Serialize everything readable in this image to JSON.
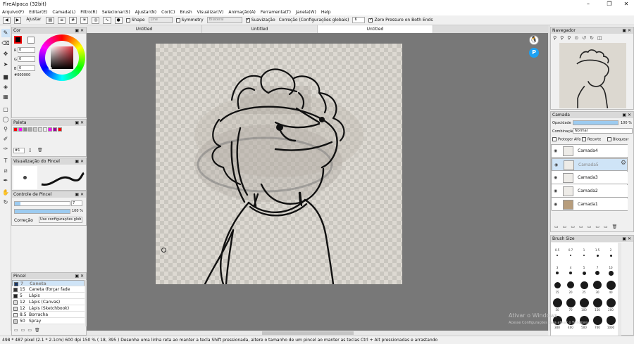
{
  "window": {
    "title": "FireAlpaca (32bit)"
  },
  "menu": [
    "Arquivo(F)",
    "Editar(E)",
    "Camada(L)",
    "Filtro(R)",
    "Selecionar(S)",
    "Ajustar(N)",
    "Cor(C)",
    "Brush",
    "Visualizar(V)",
    "Animação(A)",
    "Ferramenta(T)",
    "Janela(W)",
    "Help"
  ],
  "toolbar": {
    "adjust_label": "Ajustar",
    "shape_label": "Shape",
    "shape_value": "Line",
    "symmetry_label": "Symmetry",
    "symmetry_value": "Bilateral",
    "smoothing_label": "Suavização",
    "correction_label": "Correção (Configurações globais)",
    "correction_value": "6",
    "zero_pressure_label": "Zero Pressure on Both Ends"
  },
  "tabs": [
    "Untitled",
    "Untitled",
    "Untitled"
  ],
  "color_panel": {
    "title": "Cor",
    "r": "0",
    "g": "0",
    "b": "0",
    "hex": "#000000",
    "fg": "#000000",
    "bg": "#ffffff"
  },
  "palette_panel": {
    "title": "Paleta",
    "layer_select": "#1",
    "colors": [
      "#ff0000",
      "#ff00ff",
      "#888888",
      "#aaaaaa",
      "#cccccc",
      "#dddddd",
      "#eeeeee",
      "#ff00ff",
      "#990099",
      "#ff0000"
    ]
  },
  "brush_preview_panel": {
    "title": "Visualização do Pincel"
  },
  "brush_control_panel": {
    "title": "Controle de Pincel",
    "size": "7",
    "opacity": "100 %",
    "correction_label": "Correção",
    "correction_value": "Use configurações glob"
  },
  "brush_panel": {
    "title": "Pincel",
    "items": [
      {
        "size": "7",
        "name": "Caneta",
        "color": "#1a3a6a"
      },
      {
        "size": "15",
        "name": "Caneta (forçar fade in/out)",
        "color": "#333333"
      },
      {
        "size": "5",
        "name": "Lápis",
        "color": "#222222"
      },
      {
        "size": "12",
        "name": "Lápis (Canvas)",
        "color": "#dddddd"
      },
      {
        "size": "12",
        "name": "Lápis (Sketchbook)",
        "color": "#dddddd"
      },
      {
        "size": "8.5",
        "name": "Borracha",
        "color": "#eeeeee"
      },
      {
        "size": "50",
        "name": "Spray",
        "color": "#cccccc"
      }
    ]
  },
  "navigator_panel": {
    "title": "Navegador"
  },
  "layer_panel": {
    "title": "Camada",
    "opacity_label": "Opacidade",
    "opacity_value": "100 %",
    "blend_label": "Combinação",
    "blend_value": "Normal",
    "protect_alpha": "Proteger Alfa",
    "clipping": "Recorte",
    "lock": "Bloquear",
    "layers": [
      "Camada4",
      "Camada5",
      "Camada3",
      "Camada2",
      "Camada1"
    ],
    "selected_layer": "Camada5"
  },
  "brush_size_panel": {
    "title": "Brush Size",
    "sizes": [
      "0.5",
      "0.7",
      "1",
      "1.5",
      "2",
      "3",
      "4",
      "5",
      "7",
      "10",
      "15",
      "20",
      "25",
      "30",
      "40",
      "50",
      "70",
      "100",
      "150",
      "200",
      "300",
      "400",
      "500",
      "700",
      "1000"
    ]
  },
  "watermark": {
    "line1": "Ativar o Windows",
    "line2": "Acesse Configurações para ativar o Windows."
  },
  "status": {
    "text": "498 * 487 pixel   (2.1 * 2.1cm)   600 dpi   150 %   ( 18, 395 )   Desenhe uma linha reta ao manter a tecla Shift pressionada, altere o tamanho de um pincel ao manter as teclas Ctrl + Alt pressionadas e arrastando"
  }
}
